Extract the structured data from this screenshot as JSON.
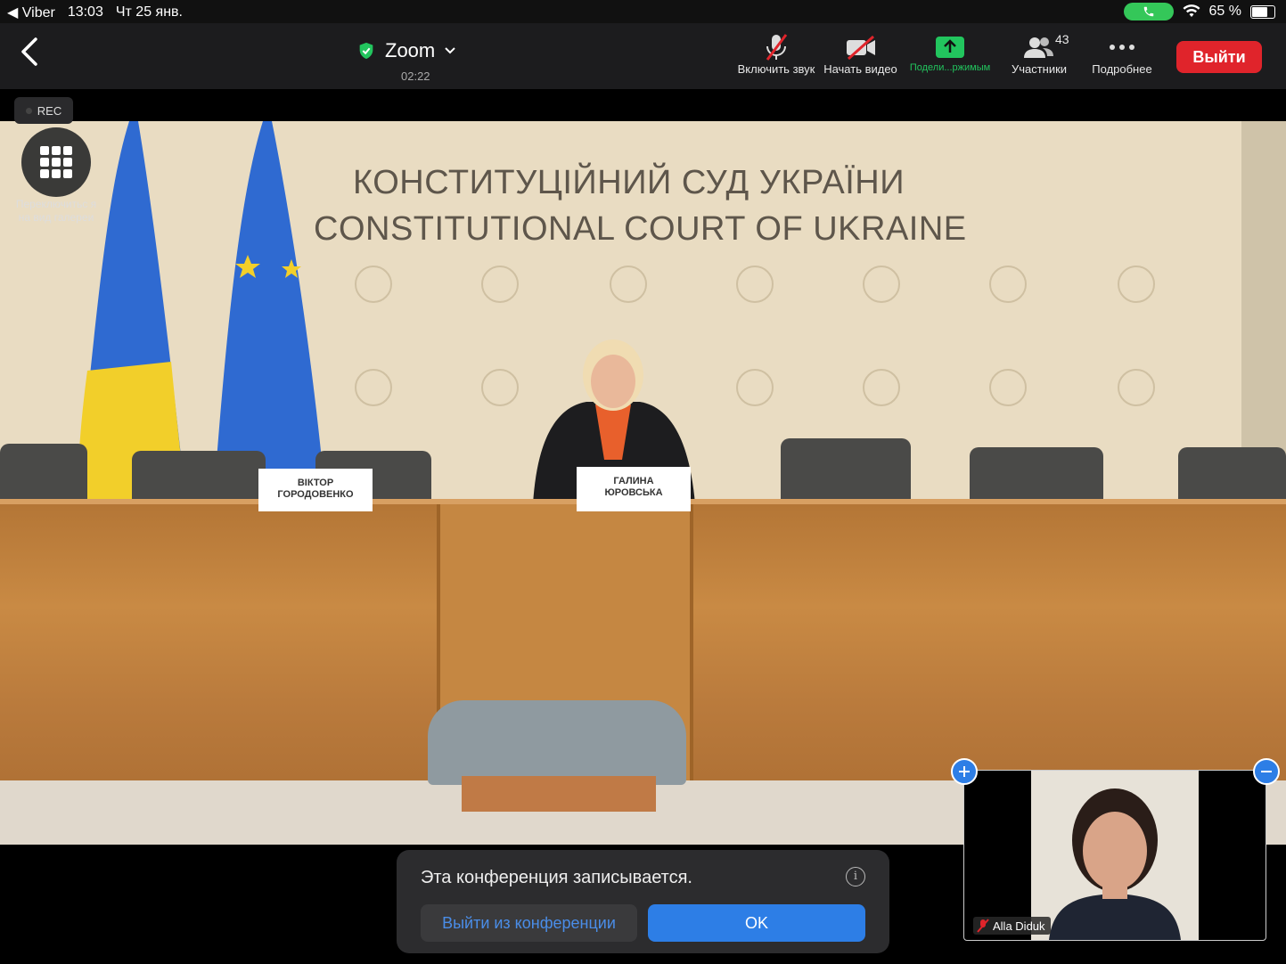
{
  "status_bar": {
    "back_app": "◀ Viber",
    "time": "13:03",
    "date": "Чт 25 янв.",
    "battery": "65 %",
    "battery_level": 0.65
  },
  "toolbar": {
    "title": "Zoom",
    "timer": "02:22",
    "unmute_label": "Включить звук",
    "start_video_label": "Начать видео",
    "share_label": "Подели...ржимым",
    "participants_label": "Участники",
    "participants_count": "43",
    "more_label": "Подробнее",
    "exit_label": "Выйти"
  },
  "video": {
    "rec_label": "REC",
    "gallery_label": "Переключитьс я на вид галереи",
    "banner_uk": "КОНСТИТУЦІЙНИЙ СУД УКРАЇНИ",
    "banner_en": "CONSTITUTIONAL COURT OF UKRAINE",
    "nameplate_1": [
      "ВІКТОР",
      "ГОРОДОВЕНКО"
    ],
    "nameplate_2": [
      "ГАЛИНА",
      "ЮРОВСЬКА"
    ]
  },
  "notice": {
    "text": "Эта конференция записывается.",
    "leave_label": "Выйти из конференции",
    "ok_label": "OK"
  },
  "self_view": {
    "name": "Alla Diduk"
  },
  "colors": {
    "exit_red": "#e0242b",
    "accent_blue": "#2d7ee6",
    "share_green": "#22c55e"
  }
}
